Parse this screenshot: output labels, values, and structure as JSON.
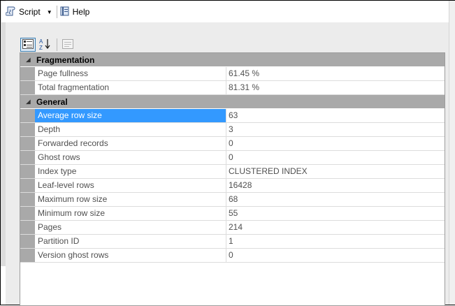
{
  "toolbar": {
    "script_label": "Script",
    "help_label": "Help"
  },
  "grid": {
    "categories": [
      {
        "name": "Fragmentation",
        "rows": [
          {
            "name": "Page fullness",
            "value": "61.45 %"
          },
          {
            "name": "Total fragmentation",
            "value": "81.31 %"
          }
        ]
      },
      {
        "name": "General",
        "rows": [
          {
            "name": "Average row size",
            "value": "63"
          },
          {
            "name": "Depth",
            "value": "3"
          },
          {
            "name": "Forwarded records",
            "value": "0"
          },
          {
            "name": "Ghost rows",
            "value": "0"
          },
          {
            "name": "Index type",
            "value": "CLUSTERED INDEX"
          },
          {
            "name": "Leaf-level rows",
            "value": "16428"
          },
          {
            "name": "Maximum row size",
            "value": "68"
          },
          {
            "name": "Minimum row size",
            "value": "55"
          },
          {
            "name": "Pages",
            "value": "214"
          },
          {
            "name": "Partition ID",
            "value": "1"
          },
          {
            "name": "Version ghost rows",
            "value": "0"
          }
        ]
      }
    ],
    "selected_row": "Average row size"
  },
  "icons": {
    "script": "script-icon",
    "help": "help-book-icon",
    "categorized": "categorized-view-icon",
    "alphabetical": "alphabetical-sort-icon",
    "property_pages": "property-pages-icon"
  },
  "colors": {
    "selection": "#3399ff",
    "category_header": "#a9a9a9"
  }
}
